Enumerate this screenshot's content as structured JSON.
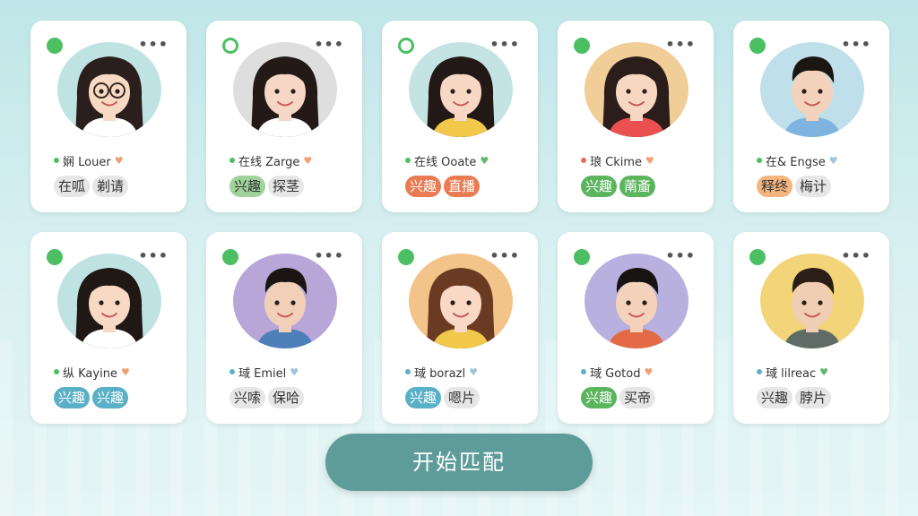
{
  "cards": [
    {
      "status": "filled",
      "bg": "#bfe3e3",
      "skin": "#f7d9c4",
      "hair": "#2a1f1c",
      "shirt": "#ffffff",
      "glasses": true,
      "boy": false,
      "dot_color": "#4cbf63",
      "name": "娴 Louer",
      "heart_color": "#f0a070",
      "tags": [
        {
          "label": "在呱",
          "bg": "#e6e6e6",
          "color": "#333333"
        },
        {
          "label": "剃请",
          "bg": "#e6e6e6",
          "color": "#333333"
        }
      ]
    },
    {
      "status": "hollow",
      "bg": "#dedede",
      "skin": "#f6d6c4",
      "hair": "#231a17",
      "shirt": "#ffffff",
      "glasses": false,
      "boy": false,
      "dot_color": "#4cbf63",
      "name": "在线 Zarge",
      "heart_color": "#f0a070",
      "tags": [
        {
          "label": "兴趣",
          "bg": "#9fd39b",
          "color": "#333333"
        },
        {
          "label": "探茎",
          "bg": "#e6e6e6",
          "color": "#333333"
        }
      ]
    },
    {
      "status": "hollow",
      "bg": "#c4e4e4",
      "skin": "#f8d8c4",
      "hair": "#221916",
      "shirt": "#f2c84b",
      "glasses": false,
      "boy": false,
      "dot_color": "#4cbf63",
      "name": "在线 Ooate",
      "heart_color": "#63b86b",
      "tags": [
        {
          "label": "兴趣",
          "bg": "#e97a52",
          "color": "#ffffff"
        },
        {
          "label": "直播",
          "bg": "#e97a52",
          "color": "#ffffff"
        }
      ]
    },
    {
      "status": "filled",
      "bg": "#f1cd97",
      "skin": "#f8d7c2",
      "hair": "#2b1e1a",
      "shirt": "#ea5050",
      "glasses": false,
      "boy": false,
      "dot_color": "#e86a57",
      "name": "琅 Ckime",
      "heart_color": "#f0a070",
      "tags": [
        {
          "label": "兴趣",
          "bg": "#5bb45e",
          "color": "#ffffff"
        },
        {
          "label": "萳齑",
          "bg": "#5bb45e",
          "color": "#ffffff"
        }
      ]
    },
    {
      "status": "filled",
      "bg": "#bfe0ea",
      "skin": "#f4d3bd",
      "hair": "#1c1613",
      "shirt": "#7fb3e0",
      "glasses": false,
      "boy": true,
      "dot_color": "#4cbf63",
      "name": "在& Engse",
      "heart_color": "#9fc5d8",
      "tags": [
        {
          "label": "释终",
          "bg": "#f6b57f",
          "color": "#333333"
        },
        {
          "label": "梅计",
          "bg": "#e6e6e6",
          "color": "#333333"
        }
      ]
    },
    {
      "status": "filled",
      "bg": "#bfe3e3",
      "skin": "#f7d9c4",
      "hair": "#1f1815",
      "shirt": "#ffffff",
      "glasses": false,
      "boy": false,
      "dot_color": "#4cbf63",
      "name": "纵 Kayine",
      "heart_color": "#f0a070",
      "tags": [
        {
          "label": "兴趣",
          "bg": "#5ab0c6",
          "color": "#ffffff"
        },
        {
          "label": "兴趣",
          "bg": "#5ab0c6",
          "color": "#ffffff"
        }
      ]
    },
    {
      "status": "filled",
      "bg": "#b8a6d8",
      "skin": "#f2d0b8",
      "hair": "#1a1512",
      "shirt": "#4e7fb8",
      "glasses": false,
      "boy": true,
      "dot_color": "#5ab0c6",
      "name": "琙 Emiel",
      "heart_color": "#9fc5d8",
      "tags": [
        {
          "label": "兴嗦",
          "bg": "#e6e6e6",
          "color": "#333333"
        },
        {
          "label": "保哈",
          "bg": "#e6e6e6",
          "color": "#333333"
        }
      ]
    },
    {
      "status": "filled",
      "bg": "#f2c48a",
      "skin": "#f9d8c6",
      "hair": "#6a3a22",
      "shirt": "#f2c84b",
      "glasses": false,
      "boy": false,
      "dot_color": "#5ab0c6",
      "name": "琙 borazl",
      "heart_color": "#9fc5d8",
      "tags": [
        {
          "label": "兴趣",
          "bg": "#5ab0c6",
          "color": "#ffffff"
        },
        {
          "label": "嗯片",
          "bg": "#e6e6e6",
          "color": "#333333"
        }
      ]
    },
    {
      "status": "filled",
      "bg": "#b8b0de",
      "skin": "#f4d2bb",
      "hair": "#171310",
      "shirt": "#e46a46",
      "glasses": false,
      "boy": true,
      "dot_color": "#5ab0c6",
      "name": "琙 Gotod",
      "heart_color": "#f0a070",
      "tags": [
        {
          "label": "兴趣",
          "bg": "#5bb45e",
          "color": "#ffffff"
        },
        {
          "label": "买帝",
          "bg": "#e6e6e6",
          "color": "#333333"
        }
      ]
    },
    {
      "status": "filled",
      "bg": "#f2d479",
      "skin": "#f0ceb4",
      "hair": "#2a1e16",
      "shirt": "#5f6b66",
      "glasses": false,
      "boy": true,
      "dot_color": "#5ab0c6",
      "name": "琙 lilreac",
      "heart_color": "#63b86b",
      "tags": [
        {
          "label": "兴趣",
          "bg": "#e6e6e6",
          "color": "#333333"
        },
        {
          "label": "脖片",
          "bg": "#e6e6e6",
          "color": "#333333"
        }
      ]
    }
  ],
  "more_label": "•••",
  "heart_glyph": "♥",
  "start_button": "开始匹配"
}
